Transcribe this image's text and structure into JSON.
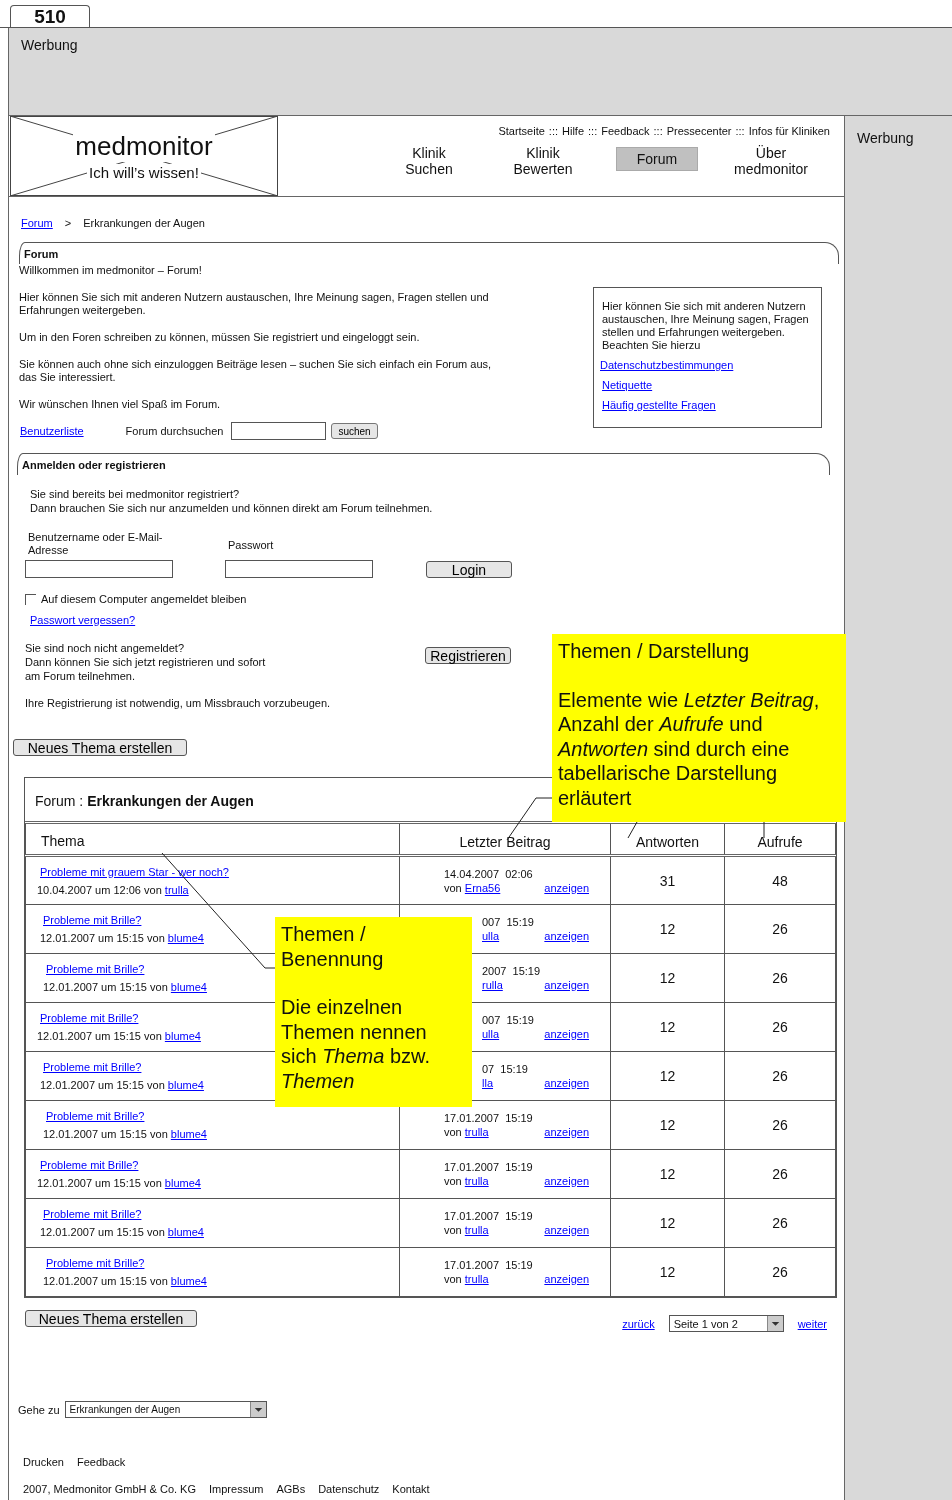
{
  "tab_label": "510",
  "top_ad": {
    "label": "Werbung"
  },
  "side_ad": {
    "label": "Werbung"
  },
  "logo": {
    "title": "medmonitor",
    "slogan": "Ich will’s wissen!"
  },
  "top_links": {
    "separator": ":::",
    "items": [
      "Startseite",
      "Hilfe",
      "Feedback",
      "Pressecenter",
      "Infos für Kliniken"
    ]
  },
  "nav": [
    {
      "label": "Klinik\nSuchen",
      "selected": false
    },
    {
      "label": "Klinik\nBewerten",
      "selected": false
    },
    {
      "label": "Forum",
      "selected": true
    },
    {
      "label": "Über\nmedmonitor",
      "selected": false
    }
  ],
  "breadcrumb": {
    "link": "Forum",
    "separator": ">",
    "current": "Erkrankungen der Augen"
  },
  "forum_intro": {
    "title": "Forum",
    "paragraphs": [
      "Willkommen im medmonitor – Forum!",
      "Hier können Sie sich mit anderen Nutzern austauschen, Ihre Meinung sagen, Fragen stellen und Erfahrungen weitergeben.",
      "Um in den Foren schreiben zu können, müssen Sie registriert und eingeloggt sein.",
      "Sie können auch ohne sich einzuloggen Beiträge lesen – suchen Sie sich einfach ein Forum aus, das Sie interessiert.",
      "Wir wünschen Ihnen viel Spaß im Forum."
    ],
    "userlist_link": "Benutzerliste",
    "search_label": "Forum durchsuchen",
    "search_button": "suchen"
  },
  "info_box": {
    "text": "Hier können Sie sich mit anderen Nutzern austauschen, Ihre Meinung sagen, Fragen stellen und Erfahrungen weitergeben. Beachten Sie hierzu",
    "links": [
      "Datenschutzbestimmungen",
      "Netiquette",
      "Häufig gestellte Fragen"
    ]
  },
  "login": {
    "title": "Anmelden oder registrieren",
    "intro": "Sie sind bereits bei medmonitor registriert?\nDann brauchen Sie sich nur anzumelden und können direkt am Forum teilnehmen.",
    "username_label": "Benutzername oder E-Mail-Adresse",
    "password_label": "Passwort",
    "login_button": "Login",
    "remember": {
      "label": "Auf diesem Computer angemeldet bleiben",
      "checked": false
    },
    "forgot_link": "Passwort vergessen?",
    "register_text": "Sie sind noch nicht angemeldet?\nDann können Sie sich jetzt registrieren und sofort\nam Forum teilnehmen.",
    "register_button": "Registrieren",
    "note": "Ihre Registrierung ist notwendig, um Missbrauch vorzubeugen."
  },
  "new_topic_button_top": "Neues Thema erstellen",
  "topic_table": {
    "caption_prefix": "Forum :",
    "caption": "Erkrankungen der Augen",
    "columns": [
      "Thema",
      "Letzter Beitrag",
      "Antworten",
      "Aufrufe"
    ],
    "rows": [
      {
        "title": "Probleme mit grauem Star - wer noch?",
        "date": "10.04.2007 um 12:06",
        "by": "von",
        "author": "trulla",
        "last_date": "14.04.2007  02:06",
        "last_by": "von",
        "last_author": "Erna56",
        "view_link": "anzeigen",
        "replies": "31",
        "views": "48"
      },
      {
        "title": "Probleme mit Brille?",
        "date": "12.01.2007 um 15:15",
        "by": "von",
        "author": "blume4",
        "last_date": "007  15:19",
        "last_author": "ulla",
        "view_link": "anzeigen",
        "replies": "12",
        "views": "26"
      },
      {
        "title": "Probleme mit Brille?",
        "date": "12.01.2007 um 15:15",
        "by": "von",
        "author": "blume4",
        "last_date": "2007  15:19",
        "last_author": "rulla",
        "view_link": "anzeigen",
        "replies": "12",
        "views": "26"
      },
      {
        "title": "Probleme mit Brille?",
        "date": "12.01.2007 um 15:15",
        "by": "von",
        "author": "blume4",
        "last_date": "007  15:19",
        "last_author": "ulla",
        "view_link": "anzeigen",
        "replies": "12",
        "views": "26"
      },
      {
        "title": "Probleme mit Brille?",
        "date": "12.01.2007 um 15:15",
        "by": "von",
        "author": "blume4",
        "last_date": "07  15:19",
        "last_author": "lla",
        "view_link": "anzeigen",
        "replies": "12",
        "views": "26"
      },
      {
        "title": "Probleme mit Brille?",
        "date": "12.01.2007 um 15:15",
        "by": "von",
        "author": "blume4",
        "last_date": "17.01.2007  15:19",
        "last_by": "von",
        "last_author": "trulla",
        "view_link": "anzeigen",
        "replies": "12",
        "views": "26"
      },
      {
        "title": "Probleme mit Brille?",
        "date": "12.01.2007 um 15:15",
        "by": "von",
        "author": "blume4",
        "last_date": "17.01.2007  15:19",
        "last_by": "von",
        "last_author": "trulla",
        "view_link": "anzeigen",
        "replies": "12",
        "views": "26"
      },
      {
        "title": "Probleme mit Brille?",
        "date": "12.01.2007 um 15:15",
        "by": "von",
        "author": "blume4",
        "last_date": "17.01.2007  15:19",
        "last_by": "von",
        "last_author": "trulla",
        "view_link": "anzeigen",
        "replies": "12",
        "views": "26"
      },
      {
        "title": "Probleme mit Brille?",
        "date": "12.01.2007 um 15:15",
        "by": "von",
        "author": "blume4",
        "last_date": "17.01.2007  15:19",
        "last_by": "von",
        "last_author": "trulla",
        "view_link": "anzeigen",
        "replies": "12",
        "views": "26"
      }
    ]
  },
  "new_topic_button_bottom": "Neues Thema erstellen",
  "pagination": {
    "prev": "zurück",
    "page_select": "Seite 1 von 2",
    "next": "weiter"
  },
  "goto": {
    "label": "Gehe zu",
    "value": "Erkrankungen der Augen"
  },
  "footer_links": [
    "Drucken",
    "Feedback"
  ],
  "copyright": "2007, Medmonitor GmbH & Co. KG",
  "legal_links": [
    "Impressum",
    "AGBs",
    "Datenschutz",
    "Kontakt"
  ],
  "notes": [
    {
      "title": "Themen / Darstellung",
      "body": "Elemente wie *Letzter Beitrag*, Anzahl der *Aufrufe* und *Antworten* sind durch eine tabellarische Darstellung erläutert"
    },
    {
      "title": "Themen / Benennung",
      "body": "Die einzelnen Themen nennen sich *Thema* bzw. *Themen*"
    }
  ]
}
